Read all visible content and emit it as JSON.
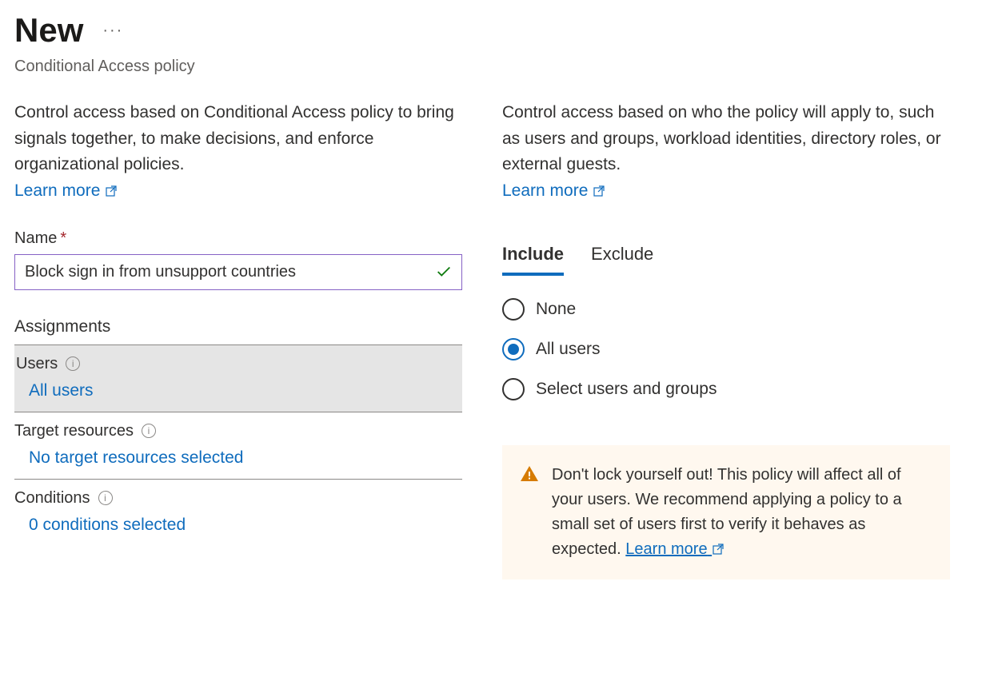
{
  "header": {
    "title": "New",
    "subtitle": "Conditional Access policy"
  },
  "left": {
    "description": "Control access based on Conditional Access policy to bring signals together, to make decisions, and enforce organizational policies.",
    "learn_more": "Learn more",
    "name_label": "Name",
    "name_value": "Block sign in from unsupport countries",
    "assignments_header": "Assignments",
    "rows": {
      "users": {
        "label": "Users",
        "value": "All users"
      },
      "target": {
        "label": "Target resources",
        "value": "No target resources selected"
      },
      "conditions": {
        "label": "Conditions",
        "value": "0 conditions selected"
      }
    }
  },
  "right": {
    "description": "Control access based on who the policy will apply to, such as users and groups, workload identities, directory roles, or external guests.",
    "learn_more": "Learn more",
    "tabs": {
      "include": "Include",
      "exclude": "Exclude"
    },
    "options": {
      "none": "None",
      "all": "All users",
      "select": "Select users and groups"
    },
    "warning": {
      "text": "Don't lock yourself out! This policy will affect all of your users. We recommend applying a policy to a small set of users first to verify it behaves as expected.",
      "learn_more": "Learn more"
    }
  }
}
